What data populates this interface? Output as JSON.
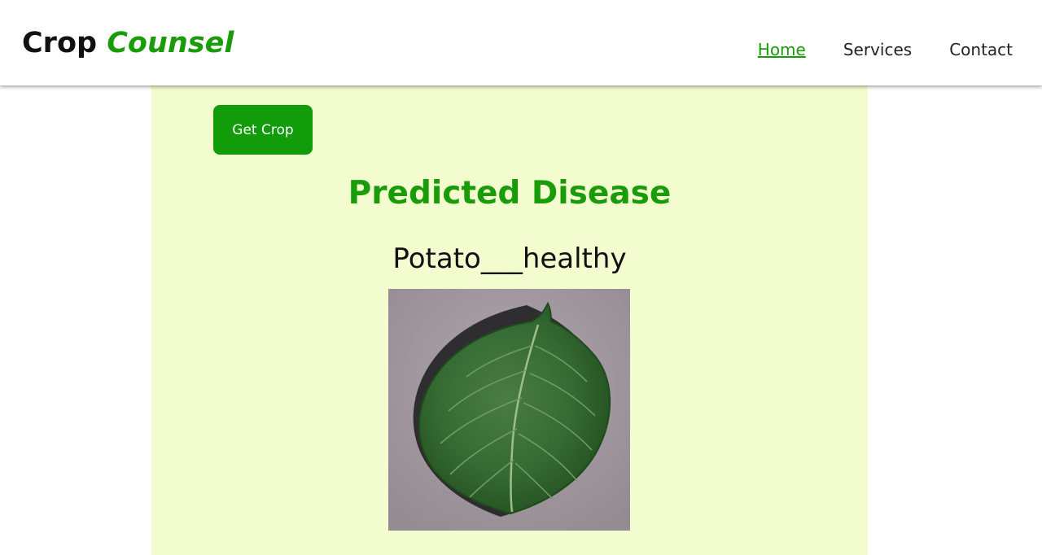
{
  "header": {
    "brand_primary": "Crop",
    "brand_accent": "Counsel",
    "nav": [
      {
        "label": "Home",
        "active": true
      },
      {
        "label": "Services",
        "active": false
      },
      {
        "label": "Contact",
        "active": false
      }
    ]
  },
  "main": {
    "get_crop_label": "Get Crop",
    "heading": "Predicted Disease",
    "prediction": "Potato___healthy",
    "image_icon": "potato-leaf-image"
  },
  "colors": {
    "accent": "#1a9c0a",
    "button": "#129c0a",
    "panel_bg": "#f3fccf"
  }
}
